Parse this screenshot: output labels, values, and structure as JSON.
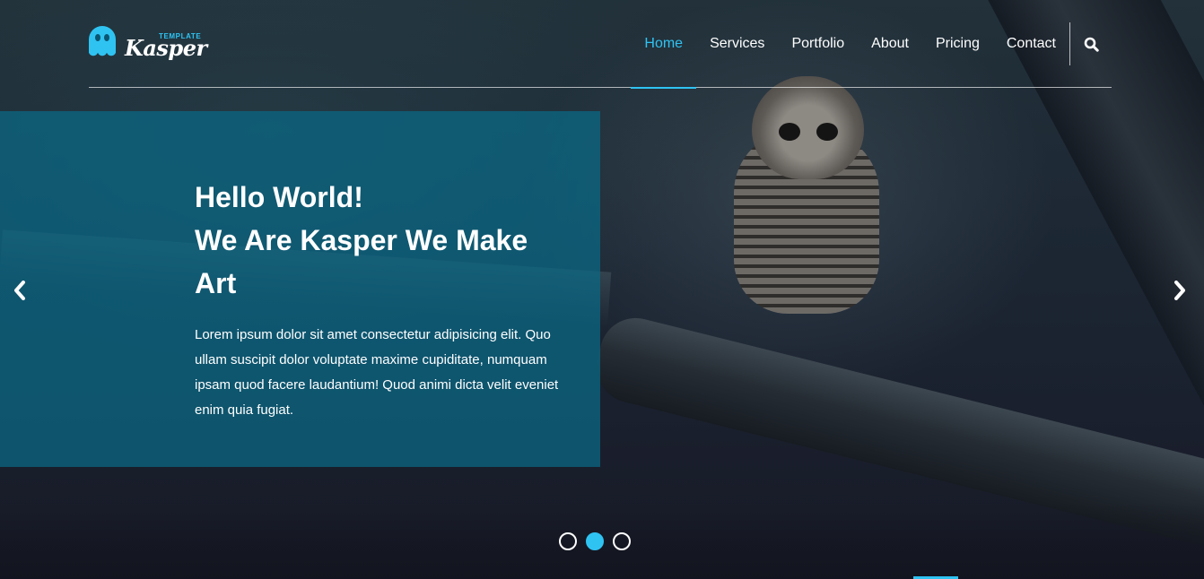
{
  "brand": {
    "name": "Kasper",
    "tag": "TEMPLATE",
    "accent_color": "#2fc3f2",
    "logo_icon": "ghost-icon"
  },
  "nav": {
    "items": [
      {
        "label": "Home",
        "active": true
      },
      {
        "label": "Services",
        "active": false
      },
      {
        "label": "Portfolio",
        "active": false
      },
      {
        "label": "About",
        "active": false
      },
      {
        "label": "Pricing",
        "active": false
      },
      {
        "label": "Contact",
        "active": false
      }
    ],
    "search_icon": "search-icon"
  },
  "hero": {
    "title_line1": "Hello World!",
    "title_line2": "We Are Kasper We Make",
    "title_line3": "Art",
    "text": "Lorem ipsum dolor sit amet consectetur adipisicing elit. Quo ullam suscipit dolor voluptate maxime cupiditate, numquam ipsam quod facere laudantium! Quod animi dicta velit eveniet enim quia fugiat.",
    "panel_color": "#0a6987"
  },
  "slider": {
    "prev_icon": "chevron-left-icon",
    "next_icon": "chevron-right-icon",
    "dots": [
      {
        "active": false
      },
      {
        "active": true
      },
      {
        "active": false
      }
    ]
  }
}
